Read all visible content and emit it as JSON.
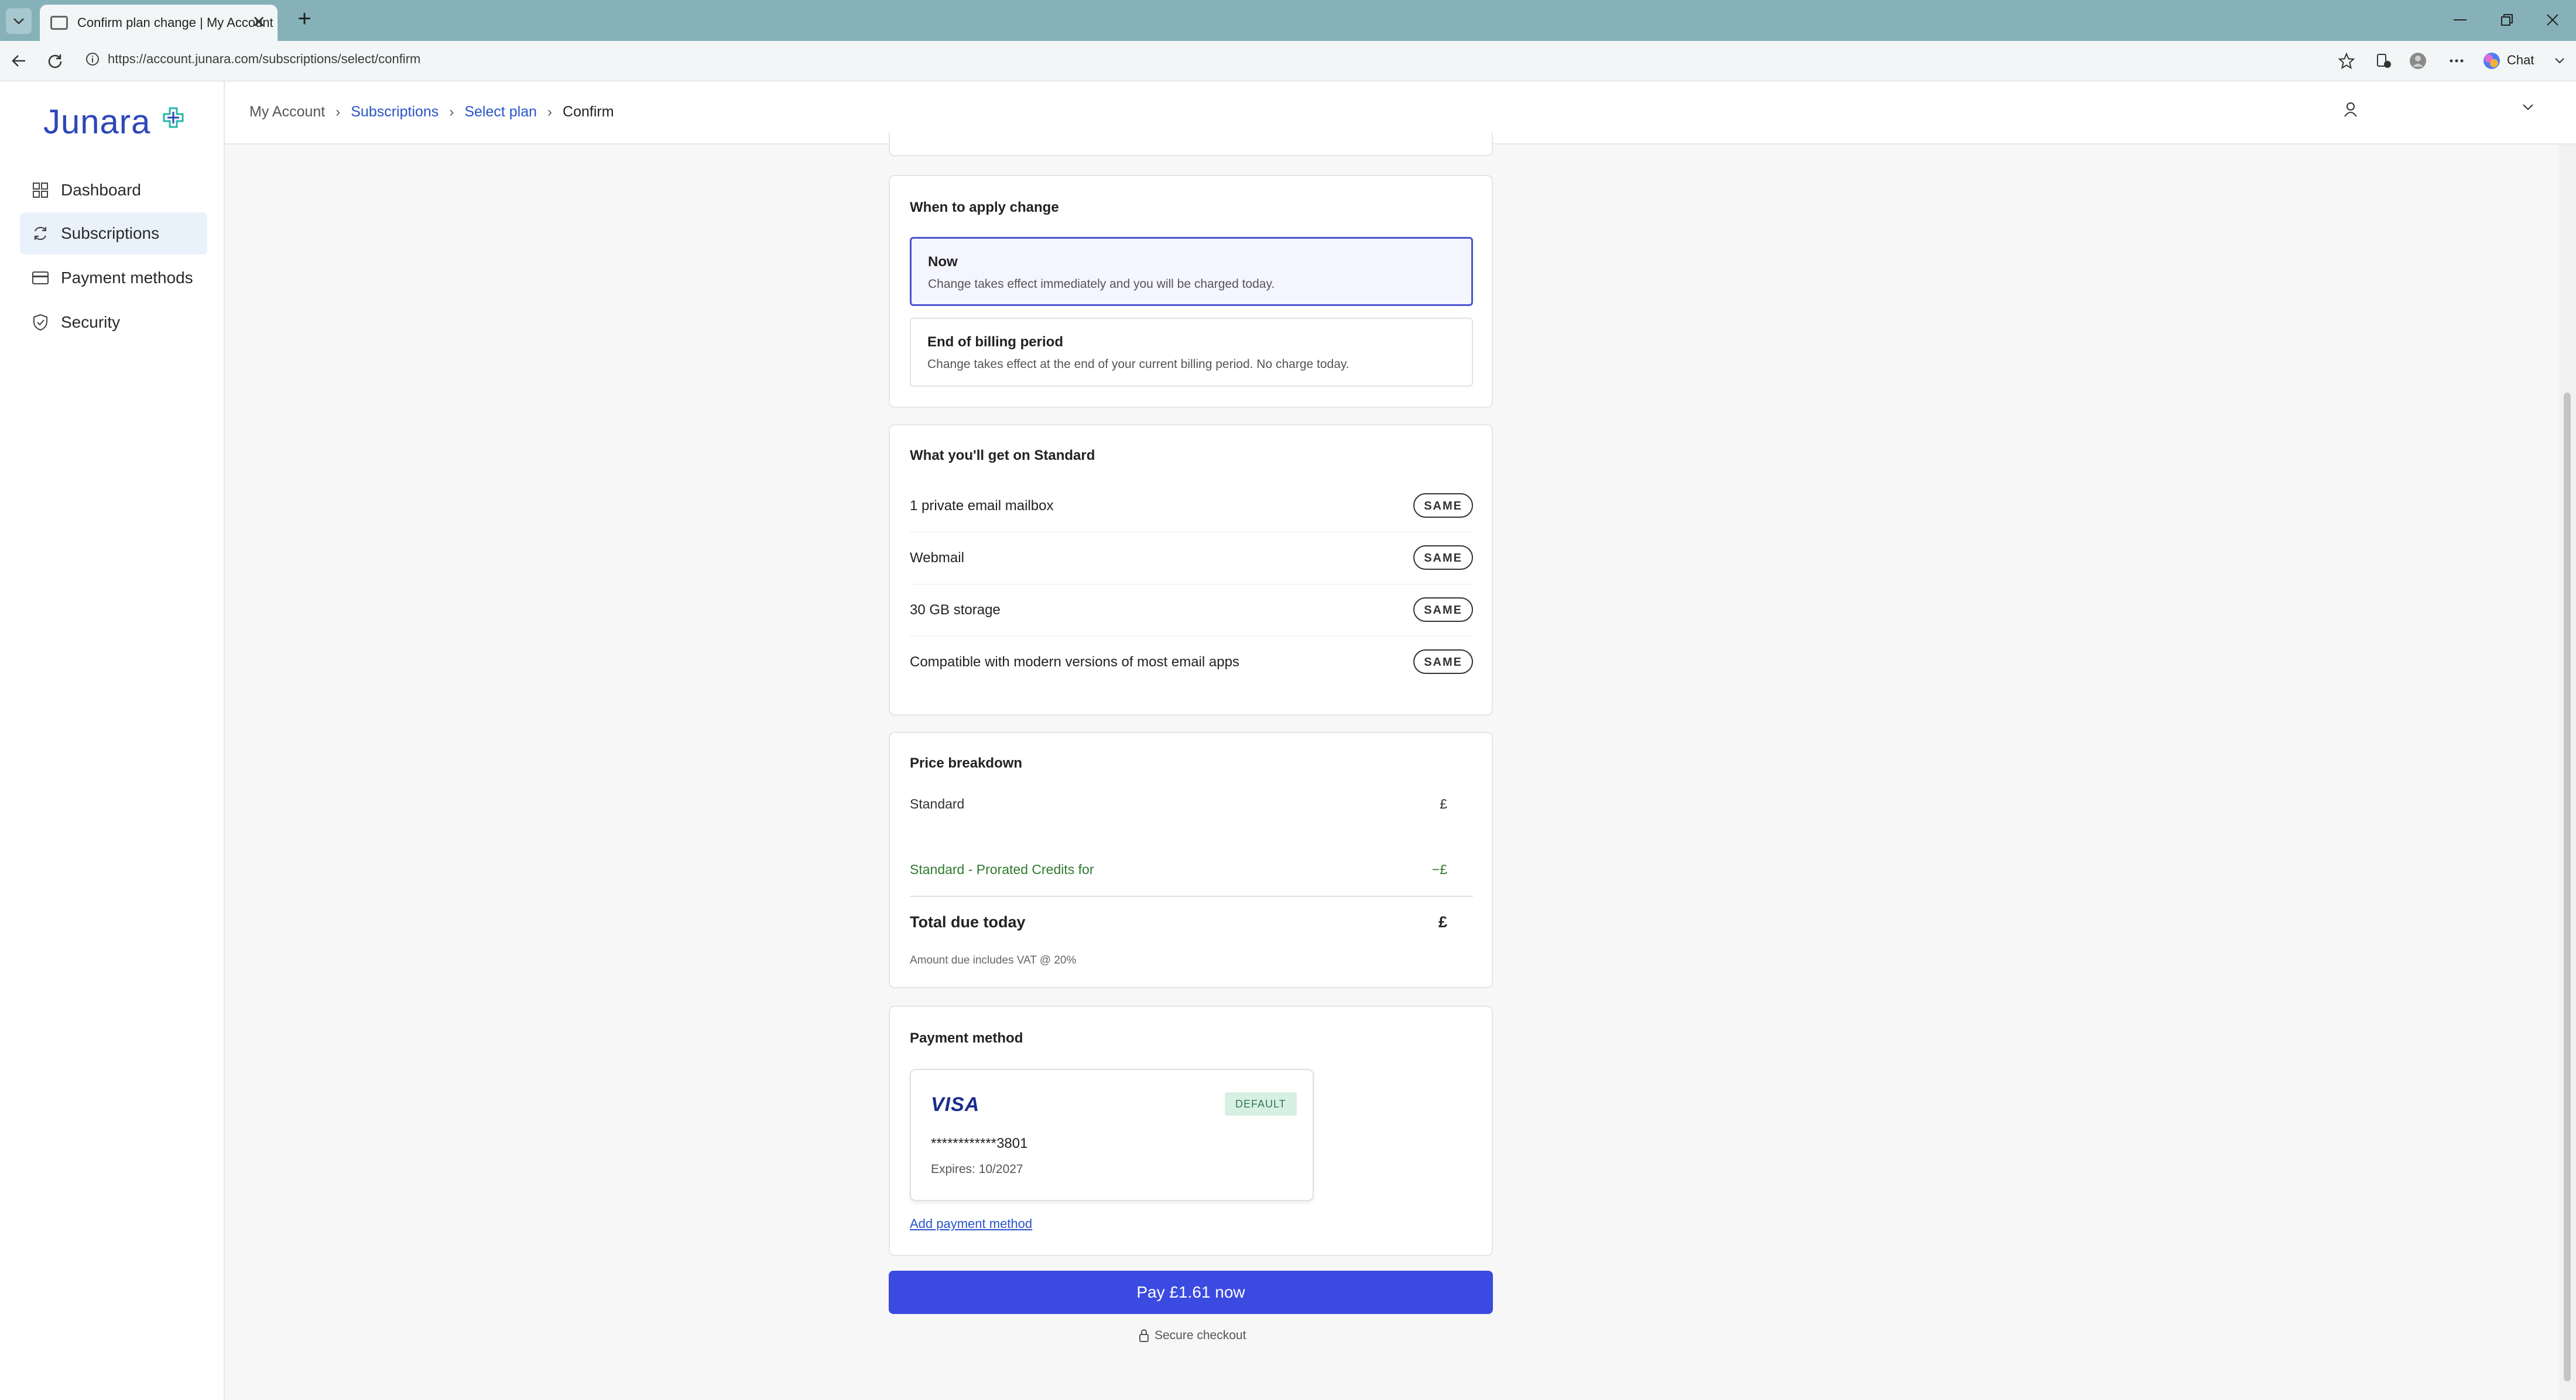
{
  "browser": {
    "tab_title": "Confirm plan change | My Account",
    "url": "https://account.junara.com/subscriptions/select/confirm",
    "chat_label": "Chat"
  },
  "sidebar": {
    "logo": "Junara",
    "items": [
      {
        "label": "Dashboard",
        "icon": "grid-icon"
      },
      {
        "label": "Subscriptions",
        "icon": "refresh-icon"
      },
      {
        "label": "Payment methods",
        "icon": "credit-card-icon"
      },
      {
        "label": "Security",
        "icon": "shield-icon"
      }
    ],
    "active_index": 1
  },
  "breadcrumb": {
    "home": "My Account",
    "subscriptions": "Subscriptions",
    "select_plan": "Select plan",
    "current": "Confirm"
  },
  "when_to_apply": {
    "title": "When to apply change",
    "options": [
      {
        "title": "Now",
        "desc": "Change takes effect immediately and you will be charged today.",
        "selected": true
      },
      {
        "title": "End of billing period",
        "desc": "Change takes effect at the end of your current billing period. No charge today.",
        "selected": false
      }
    ]
  },
  "features": {
    "title": "What you'll get on Standard",
    "items": [
      {
        "label": "1 private email mailbox",
        "badge": "SAME"
      },
      {
        "label": "Webmail",
        "badge": "SAME"
      },
      {
        "label": "30 GB storage",
        "badge": "SAME"
      },
      {
        "label": "Compatible with modern versions of most email apps",
        "badge": "SAME"
      }
    ]
  },
  "price": {
    "title": "Price breakdown",
    "line1_label": "Standard",
    "line1_value": "£",
    "line2_label": "Standard - Prorated Credits for",
    "line2_value": "−£",
    "total_label": "Total due today",
    "total_value": "£",
    "vat_note": "Amount due includes VAT @ 20%"
  },
  "payment": {
    "title": "Payment method",
    "brand": "VISA",
    "default_badge": "DEFAULT",
    "card_number": "************3801",
    "expiry": "Expires: 10/2027",
    "add_link": "Add payment method"
  },
  "pay_button": "Pay £1.61 now",
  "secure_text": "Secure checkout",
  "colors": {
    "accent": "#3b4ae0",
    "link": "#2b55c8",
    "credit_green": "#2f7a2f",
    "tabbar": "#86b1b9"
  }
}
